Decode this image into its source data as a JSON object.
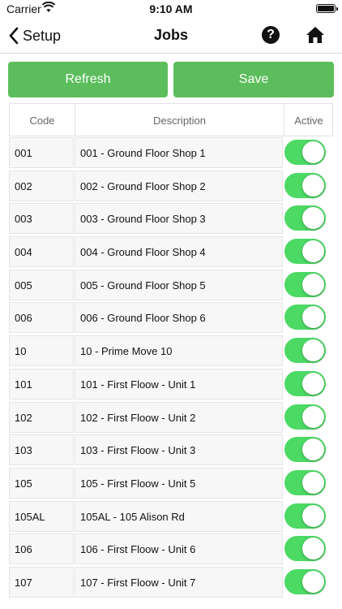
{
  "status_bar": {
    "carrier": "Carrier",
    "time": "9:10 AM"
  },
  "navbar": {
    "back_label": "Setup",
    "title": "Jobs"
  },
  "actions": {
    "refresh_label": "Refresh",
    "save_label": "Save"
  },
  "table": {
    "headers": {
      "code": "Code",
      "description": "Description",
      "active": "Active"
    },
    "rows": [
      {
        "code": "001",
        "description": "001 - Ground Floor Shop 1",
        "active": true
      },
      {
        "code": "002",
        "description": "002 - Ground Floor Shop 2",
        "active": true
      },
      {
        "code": "003",
        "description": "003 - Ground Floor Shop 3",
        "active": true
      },
      {
        "code": "004",
        "description": "004 - Ground Floor Shop 4",
        "active": true
      },
      {
        "code": "005",
        "description": "005 - Ground Floor Shop 5",
        "active": true
      },
      {
        "code": "006",
        "description": "006 - Ground Floor Shop 6",
        "active": true
      },
      {
        "code": "10",
        "description": "10 - Prime Move 10",
        "active": true
      },
      {
        "code": "101",
        "description": "101 - First Floow - Unit 1",
        "active": true
      },
      {
        "code": "102",
        "description": "102 - First Floow - Unit 2",
        "active": true
      },
      {
        "code": "103",
        "description": "103 - First Floow - Unit 3",
        "active": true
      },
      {
        "code": "105",
        "description": "105 - First Floow - Unit 5",
        "active": true
      },
      {
        "code": "105AL",
        "description": "105AL - 105 Alison Rd",
        "active": true
      },
      {
        "code": "106",
        "description": "106 - First Floow - Unit 6",
        "active": true
      },
      {
        "code": "107",
        "description": "107 - First Floow - Unit 7",
        "active": true
      }
    ]
  },
  "colors": {
    "button_green": "#5cbd5c",
    "toggle_on": "#4cd964"
  }
}
